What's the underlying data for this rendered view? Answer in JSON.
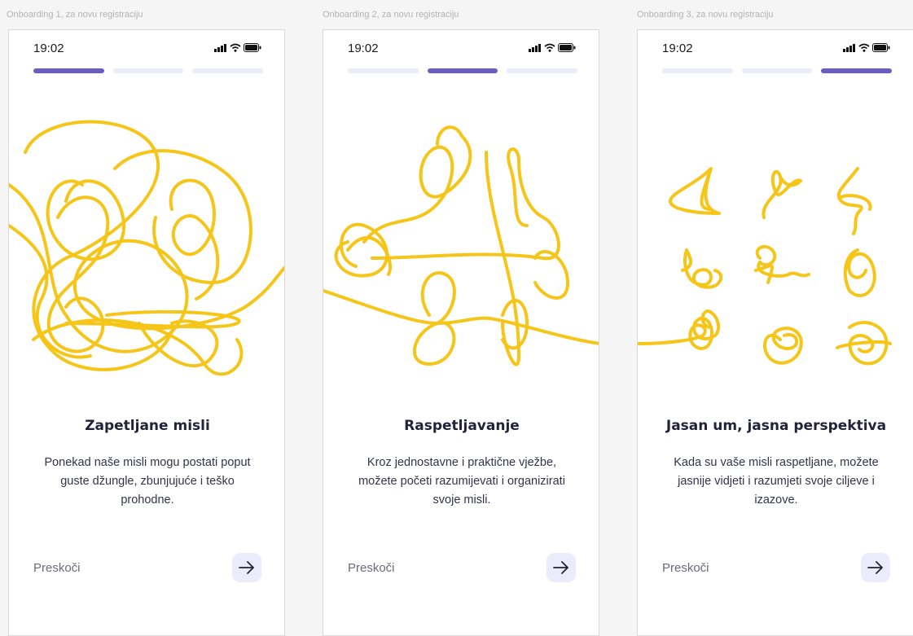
{
  "screens": [
    {
      "frame_label": "Onboarding 1, za novu registraciju",
      "time": "19:02",
      "active_step": 1,
      "title": "Zapetljane misli",
      "description": "Ponekad naše misli mogu postati poput guste džungle, zbunjujuće i teško prohodne.",
      "skip_label": "Preskoči",
      "next_icon": "arrow-right-icon"
    },
    {
      "frame_label": "Onboarding 2, za novu registraciju",
      "time": "19:02",
      "active_step": 2,
      "title": "Raspetljavanje",
      "description": "Kroz jednostavne i praktične vježbe, možete početi razumijevati i organizirati svoje misli.",
      "skip_label": "Preskoči",
      "next_icon": "arrow-right-icon"
    },
    {
      "frame_label": "Onboarding 3, za novu registraciju",
      "time": "19:02",
      "active_step": 3,
      "title": "Jasan um, jasna perspektiva",
      "description": "Kada su vaše misli raspetljane, možete jasnije vidjeti i razumjeti svoje ciljeve i izazove.",
      "skip_label": "Preskoči",
      "next_icon": "arrow-right-icon"
    }
  ],
  "colors": {
    "accent": "#6a5fc1",
    "inactive_step": "#ecebf8",
    "scribble": "#f5c518",
    "next_button_bg": "#ecebfb"
  }
}
